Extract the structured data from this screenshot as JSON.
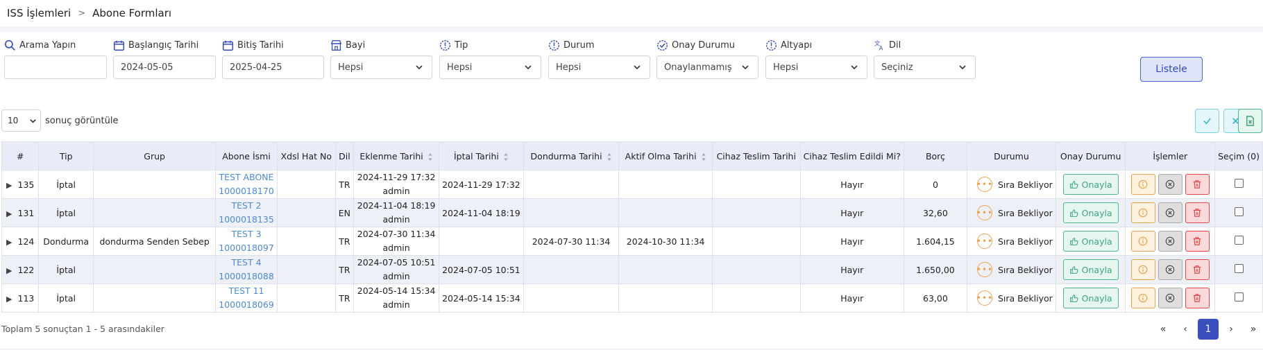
{
  "breadcrumb": {
    "root": "ISS İşlemleri",
    "separator": ">",
    "current": "Abone Formları"
  },
  "filters": {
    "search": {
      "label": "Arama Yapın",
      "value": ""
    },
    "start_date": {
      "label": "Başlangıç Tarihi",
      "value": "2024-05-05"
    },
    "end_date": {
      "label": "Bitiş Tarihi",
      "value": "2025-04-25"
    },
    "bayi": {
      "label": "Bayi",
      "value": "Hepsi"
    },
    "tip": {
      "label": "Tip",
      "value": "Hepsi"
    },
    "durum": {
      "label": "Durum",
      "value": "Hepsi"
    },
    "onay_durumu": {
      "label": "Onay Durumu",
      "value": "Onaylanmamış"
    },
    "altyapi": {
      "label": "Altyapı",
      "value": "Hepsi"
    },
    "dil": {
      "label": "Dil",
      "value": "Seçiniz"
    },
    "list_button": "Listele"
  },
  "page_length": {
    "value": "10",
    "suffix": "sonuç görüntüle"
  },
  "table": {
    "headers": [
      "#",
      "Tip",
      "Grup",
      "Abone İsmi",
      "Xdsl Hat No",
      "Dil",
      "Eklenme Tarihi",
      "İptal Tarihi",
      "Dondurma Tarihi",
      "Aktif Olma Tarihi",
      "Cihaz Teslim Tarihi",
      "Cihaz Teslim Edildi Mi?",
      "Borç",
      "Durumu",
      "Onay Durumu",
      "İşlemler",
      "Seçim (0)"
    ],
    "rows": [
      {
        "id": "135",
        "tip": "İptal",
        "grup": "",
        "abone_name": "TEST ABONE",
        "abone_no": "1000018170",
        "xdsl": "",
        "dil": "TR",
        "eklenme_date": "2024-11-29 17:32",
        "eklenme_user": "admin",
        "iptal": "2024-11-29 17:32",
        "dondurma": "",
        "aktif": "",
        "cihaz_tarih": "",
        "cihaz_edildi": "Hayır",
        "borc": "0",
        "durum": "Sıra Bekliyor",
        "onay": "Onayla"
      },
      {
        "id": "131",
        "tip": "İptal",
        "grup": "",
        "abone_name": "TEST 2",
        "abone_no": "1000018135",
        "xdsl": "",
        "dil": "EN",
        "eklenme_date": "2024-11-04 18:19",
        "eklenme_user": "admin",
        "iptal": "2024-11-04 18:19",
        "dondurma": "",
        "aktif": "",
        "cihaz_tarih": "",
        "cihaz_edildi": "Hayır",
        "borc": "32,60",
        "durum": "Sıra Bekliyor",
        "onay": "Onayla"
      },
      {
        "id": "124",
        "tip": "Dondurma",
        "grup": "dondurma Senden Sebep",
        "abone_name": "TEST 3",
        "abone_no": "1000018097",
        "xdsl": "",
        "dil": "TR",
        "eklenme_date": "2024-07-30 11:34",
        "eklenme_user": "admin",
        "iptal": "",
        "dondurma": "2024-07-30 11:34",
        "aktif": "2024-10-30 11:34",
        "cihaz_tarih": "",
        "cihaz_edildi": "Hayır",
        "borc": "1.604,15",
        "durum": "Sıra Bekliyor",
        "onay": "Onayla"
      },
      {
        "id": "122",
        "tip": "İptal",
        "grup": "",
        "abone_name": "TEST 4",
        "abone_no": "1000018088",
        "xdsl": "",
        "dil": "TR",
        "eklenme_date": "2024-07-05 10:51",
        "eklenme_user": "admin",
        "iptal": "2024-07-05 10:51",
        "dondurma": "",
        "aktif": "",
        "cihaz_tarih": "",
        "cihaz_edildi": "Hayır",
        "borc": "1.650,00",
        "durum": "Sıra Bekliyor",
        "onay": "Onayla"
      },
      {
        "id": "113",
        "tip": "İptal",
        "grup": "",
        "abone_name": "TEST 11",
        "abone_no": "1000018069",
        "xdsl": "",
        "dil": "TR",
        "eklenme_date": "2024-05-14 15:34",
        "eklenme_user": "admin",
        "iptal": "2024-05-14 15:34",
        "dondurma": "",
        "aktif": "",
        "cihaz_tarih": "",
        "cihaz_edildi": "Hayır",
        "borc": "63,00",
        "durum": "Sıra Bekliyor",
        "onay": "Onayla"
      }
    ]
  },
  "footer": {
    "info": "Toplam 5 sonuçtan 1 - 5 arasındakiler"
  },
  "pagination": {
    "first": "«",
    "prev": "‹",
    "current": "1",
    "next": "›",
    "last": "»"
  },
  "colors": {
    "accent": "#3a4fbf",
    "approve": "#3aa87f",
    "warning": "#f0a24a",
    "danger": "#e04848",
    "link": "#4a8ad6"
  },
  "icons": {
    "search": "search-icon",
    "calendar": "calendar-icon",
    "store": "store-icon",
    "info": "info-icon",
    "check_circle": "check-circle-icon",
    "translate": "translate-icon",
    "excel": "excel-icon"
  }
}
